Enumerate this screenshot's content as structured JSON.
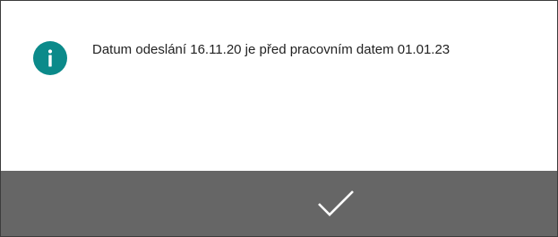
{
  "dialog": {
    "icon": "info-icon",
    "message": "Datum odeslání 16.11.20 je před pracovním datem 01.01.23",
    "accent_color": "#0b8a8a"
  },
  "actions": {
    "ok_icon": "checkmark-icon",
    "bar_color": "#666666"
  }
}
